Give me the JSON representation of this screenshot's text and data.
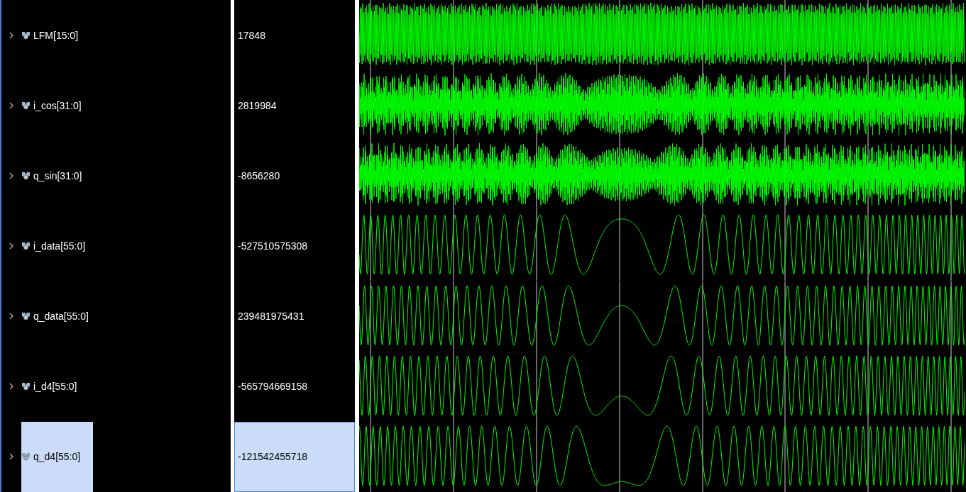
{
  "signals": [
    {
      "name": "LFM[15:0]",
      "value": "17848",
      "kind": "dense",
      "selected": false
    },
    {
      "name": "i_cos[31:0]",
      "value": "2819984",
      "kind": "envelope",
      "selected": false
    },
    {
      "name": "q_sin[31:0]",
      "value": "-8656280",
      "kind": "envelope",
      "selected": false
    },
    {
      "name": "i_data[55:0]",
      "value": "-527510575308",
      "kind": "line",
      "selected": false
    },
    {
      "name": "q_data[55:0]",
      "value": "239481975431",
      "kind": "line",
      "selected": false
    },
    {
      "name": "i_d4[55:0]",
      "value": "-565794669158",
      "kind": "line",
      "selected": false
    },
    {
      "name": "q_d4[55:0]",
      "value": "-121542455718",
      "kind": "line",
      "selected": true
    }
  ]
}
